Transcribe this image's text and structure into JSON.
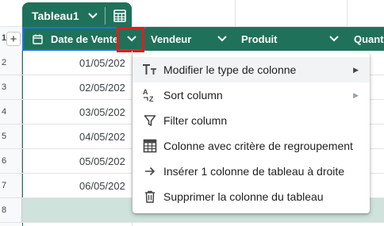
{
  "table": {
    "name": "Tableau1",
    "header_row_number": "1"
  },
  "columns": [
    {
      "label": "Date de Vente"
    },
    {
      "label": "Vendeur"
    },
    {
      "label": "Produit"
    },
    {
      "label": "Quanti"
    }
  ],
  "rows": [
    {
      "num": "2",
      "date": "01/05/202"
    },
    {
      "num": "3",
      "date": "02/05/202"
    },
    {
      "num": "4",
      "date": "03/05/202"
    },
    {
      "num": "5",
      "date": "04/05/202"
    },
    {
      "num": "6",
      "date": "05/05/202"
    },
    {
      "num": "7",
      "date": "06/05/202"
    },
    {
      "num": "8",
      "date": ""
    }
  ],
  "menu": {
    "items": [
      {
        "label": "Modifier le type de colonne",
        "icon": "text-type-icon",
        "submenu": true
      },
      {
        "label": "Sort column",
        "icon": "sort-az-icon",
        "submenu": true
      },
      {
        "label": "Filter column",
        "icon": "filter-icon",
        "submenu": false
      },
      {
        "label": "Colonne avec critère de regroupement",
        "icon": "group-by-icon",
        "submenu": false
      },
      {
        "label": "Insérer 1 colonne de tableau à droite",
        "icon": "arrow-right-icon",
        "submenu": false
      },
      {
        "label": "Supprimer la colonne du tableau",
        "icon": "trash-icon",
        "submenu": false
      }
    ]
  },
  "colors": {
    "table_header": "#20715a",
    "highlight": "#e11d1d",
    "selection": "#1a73e8"
  }
}
